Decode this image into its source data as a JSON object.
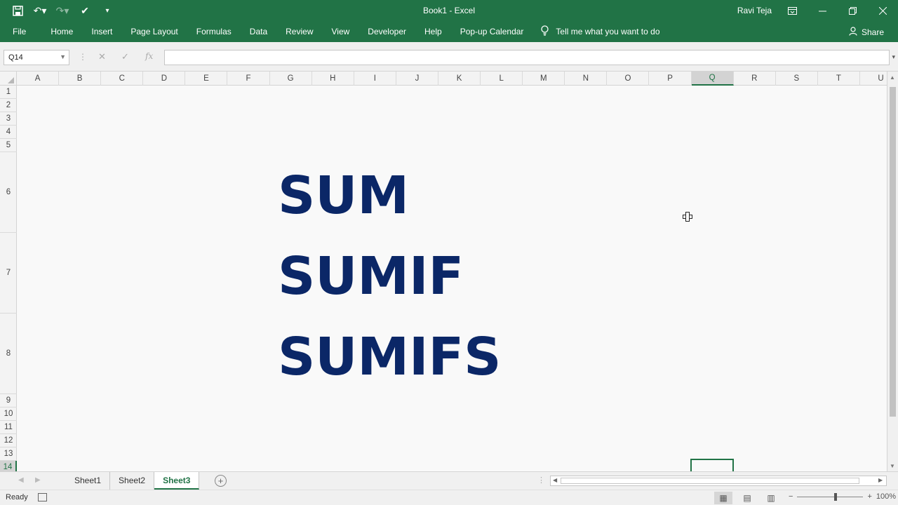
{
  "window": {
    "title": "Book1  -  Excel",
    "user": "Ravi Teja"
  },
  "ribbon": {
    "tabs": [
      "File",
      "Home",
      "Insert",
      "Page Layout",
      "Formulas",
      "Data",
      "Review",
      "View",
      "Developer",
      "Help",
      "Pop-up Calendar"
    ],
    "tell_me": "Tell me what you want to do",
    "share": "Share"
  },
  "formula_bar": {
    "name_box": "Q14",
    "fx_label": "fx",
    "formula": ""
  },
  "grid": {
    "columns": [
      "A",
      "B",
      "C",
      "D",
      "E",
      "F",
      "G",
      "H",
      "I",
      "J",
      "K",
      "L",
      "M",
      "N",
      "O",
      "P",
      "Q",
      "R",
      "S",
      "T",
      "U"
    ],
    "rows": [
      "1",
      "2",
      "3",
      "4",
      "5",
      "6",
      "7",
      "8",
      "9",
      "10",
      "11",
      "12",
      "13",
      "14"
    ],
    "selected_column": "Q",
    "selected_row": "14",
    "cells": [
      {
        "ref": "G6",
        "value": "SUM"
      },
      {
        "ref": "G7",
        "value": "SUMIF"
      },
      {
        "ref": "G8",
        "value": "SUMIFS"
      }
    ]
  },
  "sheets": {
    "tabs": [
      "Sheet1",
      "Sheet2",
      "Sheet3"
    ],
    "active": "Sheet3"
  },
  "status": {
    "text": "Ready",
    "zoom": "100%"
  }
}
